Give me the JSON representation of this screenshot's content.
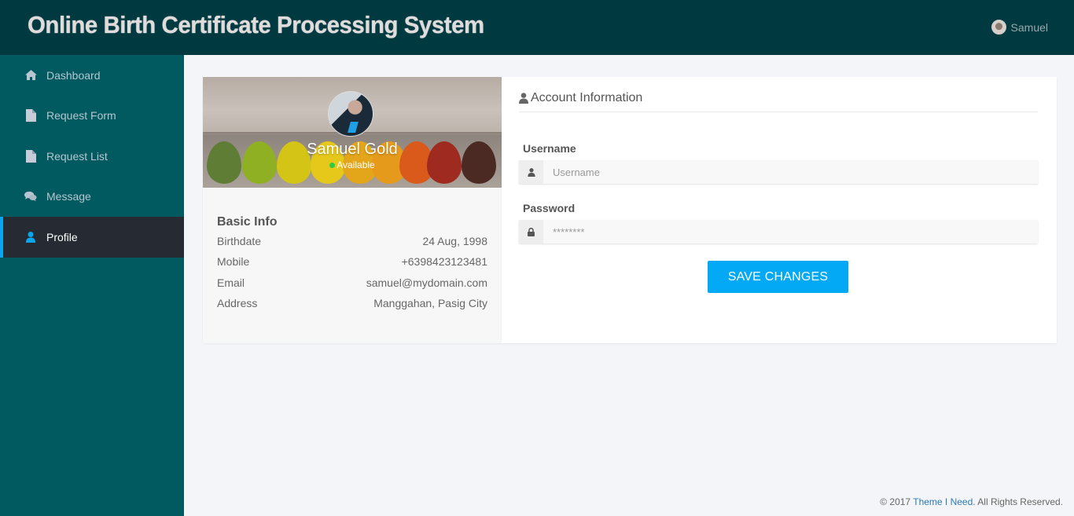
{
  "header": {
    "title": "Online Birth Certificate Processing System",
    "user_name": "Samuel",
    "avatar_icon": "user-avatar"
  },
  "sidebar": {
    "items": [
      {
        "label": "Dashboard",
        "icon": "home-icon",
        "active": false
      },
      {
        "label": "Request Form",
        "icon": "file-icon",
        "active": false
      },
      {
        "label": "Request List",
        "icon": "file-icon",
        "active": false
      },
      {
        "label": "Message",
        "icon": "comments-icon",
        "active": false
      },
      {
        "label": "Profile",
        "icon": "user-icon",
        "active": true
      }
    ]
  },
  "profile": {
    "name": "Samuel Gold",
    "status": "Available",
    "status_color": "#2ecc40",
    "basic_info": {
      "title": "Basic Info",
      "rows": [
        {
          "label": "Birthdate",
          "value": "24 Aug, 1998"
        },
        {
          "label": "Mobile",
          "value": "+6398423123481"
        },
        {
          "label": "Email",
          "value": "samuel@mydomain.com"
        },
        {
          "label": "Address",
          "value": "Manggahan, Pasig City"
        }
      ]
    }
  },
  "account": {
    "title": "Account Information",
    "username": {
      "label": "Username",
      "value": "",
      "placeholder": "Username"
    },
    "password": {
      "label": "Password",
      "value": "",
      "placeholder": "********"
    },
    "save_label": "SAVE CHANGES"
  },
  "footer": {
    "prefix": "© 2017 ",
    "link": "Theme I Need",
    "suffix": ". All Rights Reserved."
  },
  "colors": {
    "topbar": "#003a40",
    "sidebar": "#005a60",
    "active_item": "#262b33",
    "accent": "#0aa7ef",
    "button": "#03a9f4"
  }
}
